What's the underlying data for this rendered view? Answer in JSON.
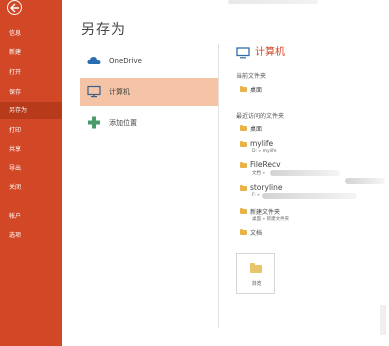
{
  "colors": {
    "accent": "#D24726",
    "rail_active": "#B73A1B",
    "place_active": "#F5C4A7",
    "folder": "#E8B44A"
  },
  "rail": {
    "back_icon": "back-arrow-icon",
    "items": [
      {
        "label": "信息"
      },
      {
        "label": "新建"
      },
      {
        "label": "打开"
      },
      {
        "label": "保存"
      },
      {
        "label": "另存为",
        "active": true
      },
      {
        "label": "打印"
      },
      {
        "label": "共享"
      },
      {
        "label": "导出"
      },
      {
        "label": "关闭"
      },
      {
        "label": "帐户"
      },
      {
        "label": "选项"
      }
    ]
  },
  "page": {
    "title": "另存为"
  },
  "places": [
    {
      "label": "OneDrive",
      "icon": "cloud-icon"
    },
    {
      "label": "计算机",
      "icon": "computer-icon",
      "active": true
    },
    {
      "label": "添加位置",
      "icon": "plus-icon"
    }
  ],
  "pane": {
    "heading": "计算机",
    "current_section": "当前文件夹",
    "current_folder": "桌面",
    "recent_section": "最近访问的文件夹",
    "recent": [
      {
        "name": "桌面",
        "path": ""
      },
      {
        "name": "mylife",
        "path": "D: » mylife"
      },
      {
        "name": "FileRecv",
        "path": "文档 »"
      },
      {
        "name": "storyline",
        "path": "F: »"
      },
      {
        "name": "新建文件夹",
        "path": "桌面 » 新建文件夹"
      },
      {
        "name": "文档",
        "path": ""
      }
    ],
    "browse_label": "浏览"
  }
}
